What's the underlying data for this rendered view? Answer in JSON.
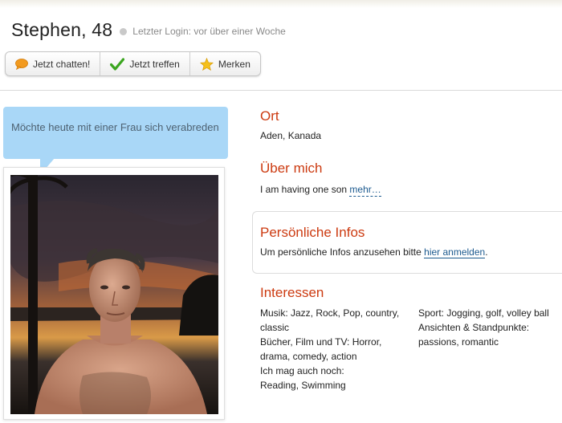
{
  "profile": {
    "name": "Stephen, 48",
    "last_login": "Letzter Login: vor über einer Woche"
  },
  "actions": {
    "chat_label": "Jetzt chatten!",
    "meet_label": "Jetzt treffen",
    "save_label": "Merken",
    "icons": [
      "speech-bubble-icon",
      "checkmark-icon",
      "star-icon"
    ]
  },
  "bubble": {
    "text": "Möchte heute mit einer Frau sich verabreden"
  },
  "location": {
    "title": "Ort",
    "value": "Aden, Kanada"
  },
  "about": {
    "title": "Über mich",
    "text": "I am having one son",
    "more_label": "mehr…"
  },
  "personal": {
    "title": "Persönliche Infos",
    "text": "Um persönliche Infos anzusehen bitte",
    "link_label": "hier anmelden",
    "suffix": "."
  },
  "interests": {
    "title": "Interessen",
    "left": [
      "Musik: Jazz, Rock, Pop, country,\nclassic",
      "Bücher, Film und TV: Horror,\ndrama, comedy, action",
      "Ich mag auch noch:\nReading, Swimming"
    ],
    "right": [
      "Sport: Jogging, golf, volley ball",
      "Ansichten & Standpunkte:\npassions, romantic"
    ]
  },
  "colors": {
    "section_title": "#cc3a10",
    "bubble": "#a9d7f7",
    "link": "#1c5a8f"
  }
}
